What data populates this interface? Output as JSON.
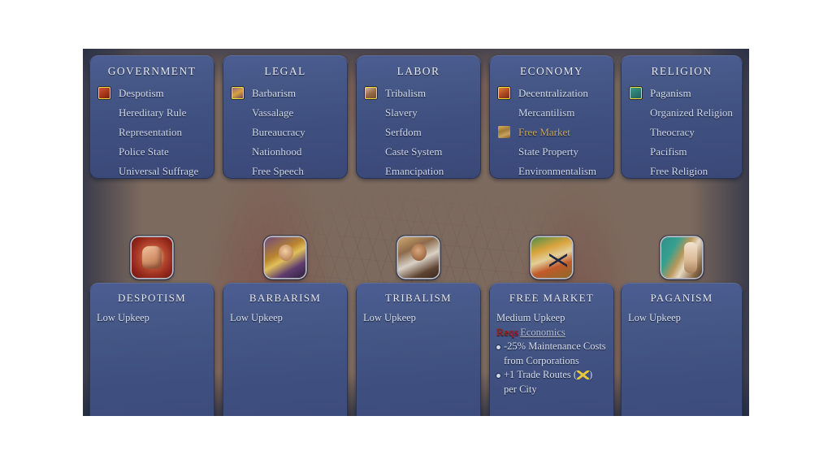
{
  "screen": {
    "bg_color": "#ffffff",
    "frame_color": "#2a3a5c"
  },
  "colors": {
    "panel_blue": "#44558a",
    "title_text": "#e8eaf2",
    "body_text": "#cfd7ea",
    "hover_gold": "#c9a95e",
    "reqs_red": "#a51e1e",
    "select_border": "#f4dd36"
  },
  "categories": [
    {
      "title": "GOVERNMENT",
      "civics": [
        {
          "label": "Despotism",
          "state": "selected",
          "icon": "fist-icon"
        },
        {
          "label": "Hereditary Rule",
          "state": "normal",
          "icon": ""
        },
        {
          "label": "Representation",
          "state": "normal",
          "icon": ""
        },
        {
          "label": "Police State",
          "state": "normal",
          "icon": ""
        },
        {
          "label": "Universal Suffrage",
          "state": "normal",
          "icon": ""
        }
      ]
    },
    {
      "title": "LEGAL",
      "civics": [
        {
          "label": "Barbarism",
          "state": "selected",
          "icon": "barbarian-icon"
        },
        {
          "label": "Vassalage",
          "state": "normal",
          "icon": ""
        },
        {
          "label": "Bureaucracy",
          "state": "normal",
          "icon": ""
        },
        {
          "label": "Nationhood",
          "state": "normal",
          "icon": ""
        },
        {
          "label": "Free Speech",
          "state": "normal",
          "icon": ""
        }
      ]
    },
    {
      "title": "LABOR",
      "civics": [
        {
          "label": "Tribalism",
          "state": "selected",
          "icon": "tribal-icon"
        },
        {
          "label": "Slavery",
          "state": "normal",
          "icon": ""
        },
        {
          "label": "Serfdom",
          "state": "normal",
          "icon": ""
        },
        {
          "label": "Caste System",
          "state": "normal",
          "icon": ""
        },
        {
          "label": "Emancipation",
          "state": "normal",
          "icon": ""
        }
      ]
    },
    {
      "title": "ECONOMY",
      "civics": [
        {
          "label": "Decentralization",
          "state": "selected",
          "icon": "decentralization-icon"
        },
        {
          "label": "Mercantilism",
          "state": "normal",
          "icon": ""
        },
        {
          "label": "Free Market",
          "state": "hovered",
          "icon": "market-icon"
        },
        {
          "label": "State Property",
          "state": "normal",
          "icon": ""
        },
        {
          "label": "Environmentalism",
          "state": "normal",
          "icon": ""
        }
      ]
    },
    {
      "title": "RELIGION",
      "civics": [
        {
          "label": "Paganism",
          "state": "selected",
          "icon": "paganism-icon"
        },
        {
          "label": "Organized Religion",
          "state": "normal",
          "icon": ""
        },
        {
          "label": "Theocracy",
          "state": "normal",
          "icon": ""
        },
        {
          "label": "Pacifism",
          "state": "normal",
          "icon": ""
        },
        {
          "label": "Free Religion",
          "state": "normal",
          "icon": ""
        }
      ]
    }
  ],
  "civic_icons": [
    {
      "name": "despotism-portrait",
      "alt": "red fist"
    },
    {
      "name": "barbarism-portrait",
      "alt": "drinking barbarian"
    },
    {
      "name": "tribalism-portrait",
      "alt": "tribal elder"
    },
    {
      "name": "free-market-portrait",
      "alt": "market stall with trade arrows"
    },
    {
      "name": "paganism-portrait",
      "alt": "nature spirit figure"
    }
  ],
  "details": [
    {
      "title": "DESPOTISM",
      "upkeep": "Low Upkeep",
      "reqs_label": "",
      "reqs_tech": "",
      "effects": []
    },
    {
      "title": "BARBARISM",
      "upkeep": "Low Upkeep",
      "reqs_label": "",
      "reqs_tech": "",
      "effects": []
    },
    {
      "title": "TRIBALISM",
      "upkeep": "Low Upkeep",
      "reqs_label": "",
      "reqs_tech": "",
      "effects": []
    },
    {
      "title": "FREE MARKET",
      "upkeep": "Medium Upkeep",
      "reqs_label": "Reqs",
      "reqs_tech": "Economics",
      "effects": [
        {
          "text": "-25% Maintenance Costs from Corporations",
          "icon": ""
        },
        {
          "text": "+1 Trade Routes (",
          "suffix": ") per City",
          "icon": "trade-route-icon"
        }
      ]
    },
    {
      "title": "PAGANISM",
      "upkeep": "Low Upkeep",
      "reqs_label": "",
      "reqs_tech": "",
      "effects": []
    }
  ]
}
